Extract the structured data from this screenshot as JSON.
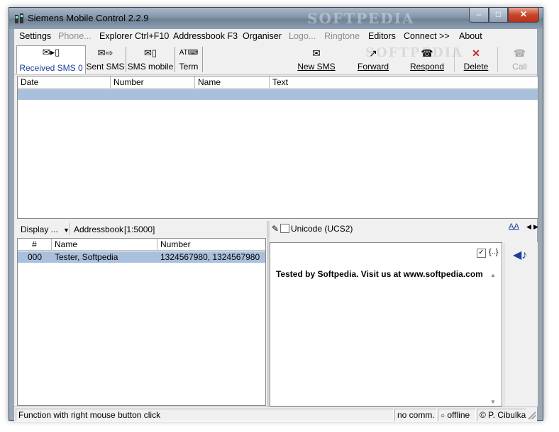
{
  "window": {
    "title": "Siemens Mobile Control 2.2.9"
  },
  "menu": [
    {
      "label": "Settings",
      "enabled": true
    },
    {
      "label": "Phone...",
      "enabled": false
    },
    {
      "label": "Explorer Ctrl+F10",
      "enabled": true
    },
    {
      "label": "Addressbook F3",
      "enabled": true
    },
    {
      "label": "Organiser",
      "enabled": true
    },
    {
      "label": "Logo...",
      "enabled": false
    },
    {
      "label": "Ringtone",
      "enabled": false
    },
    {
      "label": "Editors",
      "enabled": true
    },
    {
      "label": "Connect >>",
      "enabled": true
    },
    {
      "label": "About",
      "enabled": true
    }
  ],
  "tabs": [
    {
      "label": "Received SMS  0",
      "active": true
    },
    {
      "label": "Sent SMS",
      "active": false
    },
    {
      "label": "SMS mobile",
      "active": false
    },
    {
      "label": "Term",
      "active": false
    }
  ],
  "tools": [
    {
      "label": "New SMS",
      "enabled": true
    },
    {
      "label": "Forward",
      "enabled": true
    },
    {
      "label": "Respond",
      "enabled": true
    },
    {
      "label": "Delete",
      "enabled": true
    },
    {
      "label": "Call",
      "enabled": false
    }
  ],
  "sms_table": {
    "columns": [
      "Date",
      "Number",
      "Name",
      "Text"
    ]
  },
  "addressbook": {
    "display_label": "Display ...",
    "title": "Addressbook",
    "range": "[1:5000]",
    "columns": [
      "#",
      "Name",
      "Number"
    ],
    "rows": [
      {
        "index": "000",
        "name": "Tester, Softpedia",
        "number": "1324567980, 1324567980"
      }
    ]
  },
  "editor": {
    "unicode_label": "Unicode (UCS2)",
    "unicode_checked": false,
    "brace_label": "{..}",
    "brace_checked": true,
    "text": "Tested by Softpedia. Visit us at www.softpedia.com"
  },
  "status": {
    "hint": "Function with right mouse button click",
    "connection": "no comm.",
    "online": "offline",
    "copyright": "© P. Cibulka"
  },
  "watermark": "SOFTPEDIA",
  "colors": {
    "selection": "#a9c0dc",
    "active_tab_text": "#1a3f9e",
    "delete_icon": "#cc2222"
  }
}
